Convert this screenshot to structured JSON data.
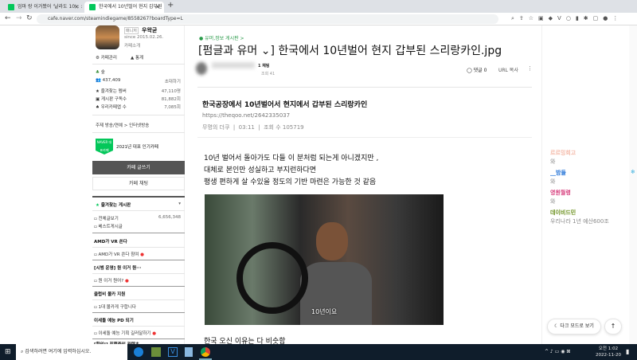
{
  "browser": {
    "tabs": [
      {
        "title": "엄마 랑 이거봤어 '날라도 10' : :"
      },
      {
        "title": "한국에서 10년벌어 현지 갑부된"
      }
    ],
    "new_tab": "+",
    "url": "cafe.naver.com/steamindiegame/8558267?boardType=L"
  },
  "sidebar": {
    "manager_badge": "매니저",
    "cafe_name": "우왁굳",
    "since": "since 2015.02.26.",
    "intro": "카페소개",
    "admin": "카페관리",
    "stats": "통계",
    "level": "숲",
    "members": "437,409",
    "invite": "초대하기",
    "stats_rows": [
      {
        "label": "즐겨찾는 멤버",
        "value": "47,110명"
      },
      {
        "label": "게시판 구독수",
        "value": "81,882회"
      },
      {
        "label": "우리카페앱 수",
        "value": "7,085회"
      }
    ],
    "theme": "주제  방송/연예 > 인터넷방송",
    "naver_badge": "NAVER 대표카페",
    "award": "2021년 대표 인기카페",
    "write": "카페 글쓰기",
    "chat": "카페 채팅",
    "fav_boards": "즐겨찾는 게시판",
    "all_posts": "전체글보기",
    "all_count": "6,656,348",
    "best": "베스트게시글",
    "sections": [
      {
        "title": "AMD가 VR 쏜다",
        "item": "AMD가 VR 쏜다 참여",
        "new": true
      },
      {
        "title": "[시범 운영] 뭔 이거 뭔···",
        "item": "뭔 이거 뭔어?",
        "new": true
      },
      {
        "title": "클럽비 몰카 지원",
        "item": "1대 몰카게 구합니다",
        "new": false
      },
      {
        "title": "이세돌 예능 PD 되기",
        "item": "이세돌 예능 기획 길러달하기",
        "new": true
      },
      {
        "title": "[확인!] 진행중인 컨텐츠",
        "item": "",
        "new": false
      }
    ]
  },
  "post": {
    "board": "유머,정보 게시판 >",
    "title": "[펌글과 유머 ⌄] 한국에서 10년벌어 현지 갑부된 스리랑카인.jpg",
    "author_level": "1 채팅",
    "views_meta": "조회 41",
    "comments": "댓글 0",
    "url_copy": "URL 복사",
    "more": "⋮",
    "quote_title": "한국공장에서 10년벌어서 현지에서 갑부된 스리랑카인",
    "quote_link": "https://theqoo.net/2642335037",
    "quote_meta": "무명의 더쿠  |  03:11  |  조회 수 105719",
    "body": [
      "10년 벌어서 돌아가도 다들 이 분처럼 되는게 아니겠지만 ,",
      "대체로 본인만 성실하고 부지런하다면",
      "평생 편하게 살 수있을 정도의 기반 마련은 가능한 것 같음"
    ],
    "caption": "10년이요",
    "after": "한국 오신 이유는 다 비슷함"
  },
  "right": {
    "comments": [
      {
        "name": "르르밍희고",
        "text": "와",
        "color": "#f4b9a8"
      },
      {
        "name": "__밤들",
        "text": "와",
        "color": "#1d6fd6"
      },
      {
        "name": "영원월령",
        "text": "와",
        "color": "#d63a7a"
      },
      {
        "name": "데이비드민",
        "text": "우리나라 1년 예산600조",
        "color": "#6a8f1c"
      }
    ],
    "dark_mode": "다크 모드로 보기",
    "top": "↑"
  },
  "taskbar": {
    "search": "검색하려면 여기에 입력하십시오.",
    "time": "오전 1:02",
    "date": "2022-11-20"
  }
}
